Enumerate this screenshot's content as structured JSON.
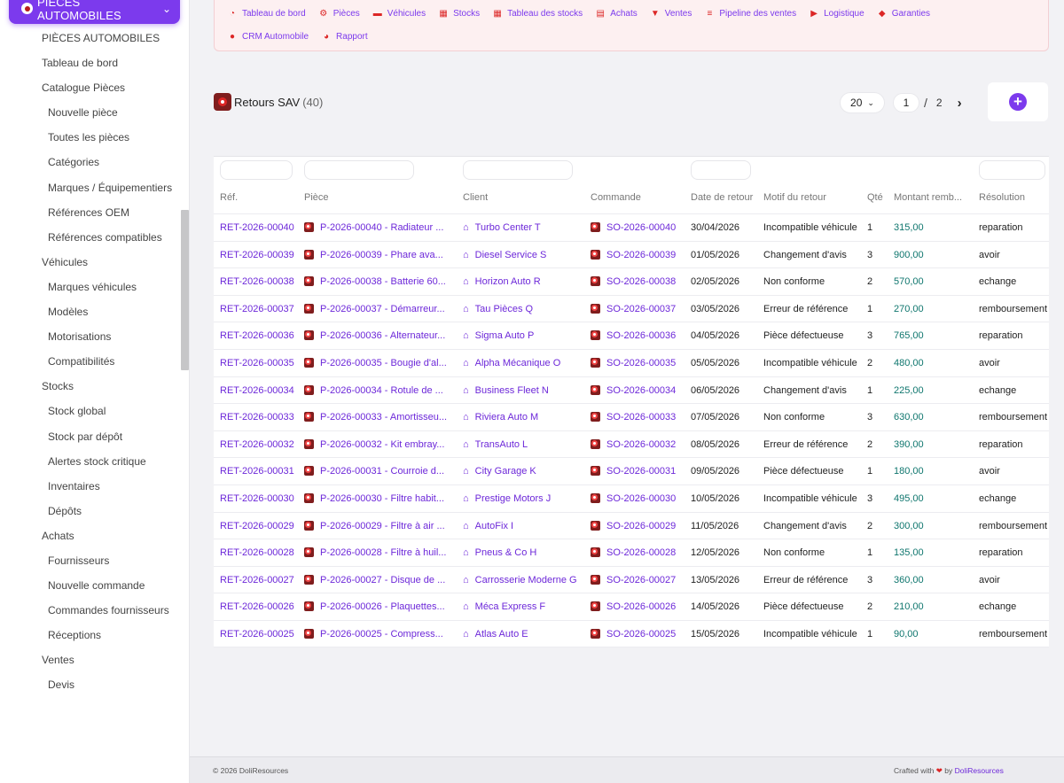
{
  "sidebar": {
    "module_label": "PIÈCES AUTOMOBILES",
    "items": [
      {
        "label": "PIÈCES AUTOMOBILES",
        "level": 1
      },
      {
        "label": "Tableau de bord",
        "level": 1
      },
      {
        "label": "Catalogue Pièces",
        "level": 1
      },
      {
        "label": "Nouvelle pièce",
        "level": 2
      },
      {
        "label": "Toutes les pièces",
        "level": 2
      },
      {
        "label": "Catégories",
        "level": 2
      },
      {
        "label": "Marques / Équipementiers",
        "level": 2
      },
      {
        "label": "Références OEM",
        "level": 2
      },
      {
        "label": "Références compatibles",
        "level": 2
      },
      {
        "label": "Véhicules",
        "level": 1
      },
      {
        "label": "Marques véhicules",
        "level": 2
      },
      {
        "label": "Modèles",
        "level": 2
      },
      {
        "label": "Motorisations",
        "level": 2
      },
      {
        "label": "Compatibilités",
        "level": 2
      },
      {
        "label": "Stocks",
        "level": 1
      },
      {
        "label": "Stock global",
        "level": 2
      },
      {
        "label": "Stock par dépôt",
        "level": 2
      },
      {
        "label": "Alertes stock critique",
        "level": 2
      },
      {
        "label": "Inventaires",
        "level": 2
      },
      {
        "label": "Dépôts",
        "level": 2
      },
      {
        "label": "Achats",
        "level": 1
      },
      {
        "label": "Fournisseurs",
        "level": 2
      },
      {
        "label": "Nouvelle commande",
        "level": 2
      },
      {
        "label": "Commandes fournisseurs",
        "level": 2
      },
      {
        "label": "Réceptions",
        "level": 2
      },
      {
        "label": "Ventes",
        "level": 1
      },
      {
        "label": "Devis",
        "level": 2
      }
    ]
  },
  "topnav": {
    "row1": [
      {
        "label": "Tableau de bord",
        "icon": "dashboard-icon"
      },
      {
        "label": "Pièces",
        "icon": "gear-icon"
      },
      {
        "label": "Véhicules",
        "icon": "car-icon"
      },
      {
        "label": "Stocks",
        "icon": "boxes-icon"
      },
      {
        "label": "Tableau des stocks",
        "icon": "grid-icon"
      },
      {
        "label": "Achats",
        "icon": "invoice-icon"
      },
      {
        "label": "Ventes",
        "icon": "cart-icon"
      },
      {
        "label": "Pipeline des ventes",
        "icon": "list-icon"
      },
      {
        "label": "Logistique",
        "icon": "truck-icon"
      },
      {
        "label": "Garanties",
        "icon": "shield-icon"
      }
    ],
    "row2": [
      {
        "label": "CRM Automobile",
        "icon": "user-plus-icon"
      },
      {
        "label": "Rapport",
        "icon": "pie-chart-icon"
      }
    ]
  },
  "page": {
    "title": "Retours SAV",
    "count": "(40)"
  },
  "pagination": {
    "per_page": "20",
    "current": "1",
    "separator": "/",
    "total": "2"
  },
  "table": {
    "headers": [
      "Réf.",
      "Pièce",
      "Client",
      "Commande",
      "Date de retour",
      "Motif du retour",
      "Qté",
      "Montant remb...",
      "Résolution"
    ],
    "rows": [
      {
        "ref": "RET-2026-00040",
        "piece": "P-2026-00040 - Radiateur ...",
        "client": "Turbo Center T",
        "commande": "SO-2026-00040",
        "date": "30/04/2026",
        "motif": "Incompatible véhicule",
        "qte": "1",
        "montant": "315,00",
        "resolution": "reparation"
      },
      {
        "ref": "RET-2026-00039",
        "piece": "P-2026-00039 - Phare ava...",
        "client": "Diesel Service S",
        "commande": "SO-2026-00039",
        "date": "01/05/2026",
        "motif": "Changement d'avis",
        "qte": "3",
        "montant": "900,00",
        "resolution": "avoir"
      },
      {
        "ref": "RET-2026-00038",
        "piece": "P-2026-00038 - Batterie 60...",
        "client": "Horizon Auto R",
        "commande": "SO-2026-00038",
        "date": "02/05/2026",
        "motif": "Non conforme",
        "qte": "2",
        "montant": "570,00",
        "resolution": "echange"
      },
      {
        "ref": "RET-2026-00037",
        "piece": "P-2026-00037 - Démarreur...",
        "client": "Tau Pièces Q",
        "commande": "SO-2026-00037",
        "date": "03/05/2026",
        "motif": "Erreur de référence",
        "qte": "1",
        "montant": "270,00",
        "resolution": "remboursement"
      },
      {
        "ref": "RET-2026-00036",
        "piece": "P-2026-00036 - Alternateur...",
        "client": "Sigma Auto P",
        "commande": "SO-2026-00036",
        "date": "04/05/2026",
        "motif": "Pièce défectueuse",
        "qte": "3",
        "montant": "765,00",
        "resolution": "reparation"
      },
      {
        "ref": "RET-2026-00035",
        "piece": "P-2026-00035 - Bougie d'al...",
        "client": "Alpha Mécanique O",
        "commande": "SO-2026-00035",
        "date": "05/05/2026",
        "motif": "Incompatible véhicule",
        "qte": "2",
        "montant": "480,00",
        "resolution": "avoir"
      },
      {
        "ref": "RET-2026-00034",
        "piece": "P-2026-00034 - Rotule de ...",
        "client": "Business Fleet N",
        "commande": "SO-2026-00034",
        "date": "06/05/2026",
        "motif": "Changement d'avis",
        "qte": "1",
        "montant": "225,00",
        "resolution": "echange"
      },
      {
        "ref": "RET-2026-00033",
        "piece": "P-2026-00033 - Amortisseu...",
        "client": "Riviera Auto M",
        "commande": "SO-2026-00033",
        "date": "07/05/2026",
        "motif": "Non conforme",
        "qte": "3",
        "montant": "630,00",
        "resolution": "remboursement"
      },
      {
        "ref": "RET-2026-00032",
        "piece": "P-2026-00032 - Kit embray...",
        "client": "TransAuto L",
        "commande": "SO-2026-00032",
        "date": "08/05/2026",
        "motif": "Erreur de référence",
        "qte": "2",
        "montant": "390,00",
        "resolution": "reparation"
      },
      {
        "ref": "RET-2026-00031",
        "piece": "P-2026-00031 - Courroie d...",
        "client": "City Garage K",
        "commande": "SO-2026-00031",
        "date": "09/05/2026",
        "motif": "Pièce défectueuse",
        "qte": "1",
        "montant": "180,00",
        "resolution": "avoir"
      },
      {
        "ref": "RET-2026-00030",
        "piece": "P-2026-00030 - Filtre habit...",
        "client": "Prestige Motors J",
        "commande": "SO-2026-00030",
        "date": "10/05/2026",
        "motif": "Incompatible véhicule",
        "qte": "3",
        "montant": "495,00",
        "resolution": "echange"
      },
      {
        "ref": "RET-2026-00029",
        "piece": "P-2026-00029 - Filtre à air ...",
        "client": "AutoFix I",
        "commande": "SO-2026-00029",
        "date": "11/05/2026",
        "motif": "Changement d'avis",
        "qte": "2",
        "montant": "300,00",
        "resolution": "remboursement"
      },
      {
        "ref": "RET-2026-00028",
        "piece": "P-2026-00028 - Filtre à huil...",
        "client": "Pneus & Co H",
        "commande": "SO-2026-00028",
        "date": "12/05/2026",
        "motif": "Non conforme",
        "qte": "1",
        "montant": "135,00",
        "resolution": "reparation"
      },
      {
        "ref": "RET-2026-00027",
        "piece": "P-2026-00027 - Disque de ...",
        "client": "Carrosserie Moderne G",
        "commande": "SO-2026-00027",
        "date": "13/05/2026",
        "motif": "Erreur de référence",
        "qte": "3",
        "montant": "360,00",
        "resolution": "avoir"
      },
      {
        "ref": "RET-2026-00026",
        "piece": "P-2026-00026 - Plaquettes...",
        "client": "Méca Express F",
        "commande": "SO-2026-00026",
        "date": "14/05/2026",
        "motif": "Pièce défectueuse",
        "qte": "2",
        "montant": "210,00",
        "resolution": "echange"
      },
      {
        "ref": "RET-2026-00025",
        "piece": "P-2026-00025 - Compress...",
        "client": "Atlas Auto E",
        "commande": "SO-2026-00025",
        "date": "15/05/2026",
        "motif": "Incompatible véhicule",
        "qte": "1",
        "montant": "90,00",
        "resolution": "remboursement"
      }
    ]
  },
  "footer": {
    "copyright": "© 2026 DoliResources",
    "crafted": "Crafted with",
    "by": "by",
    "brand": "DoliResources"
  },
  "colors": {
    "accent": "#7c3aed",
    "nav_icon": "#dc2626",
    "amount": "#0f766e"
  }
}
